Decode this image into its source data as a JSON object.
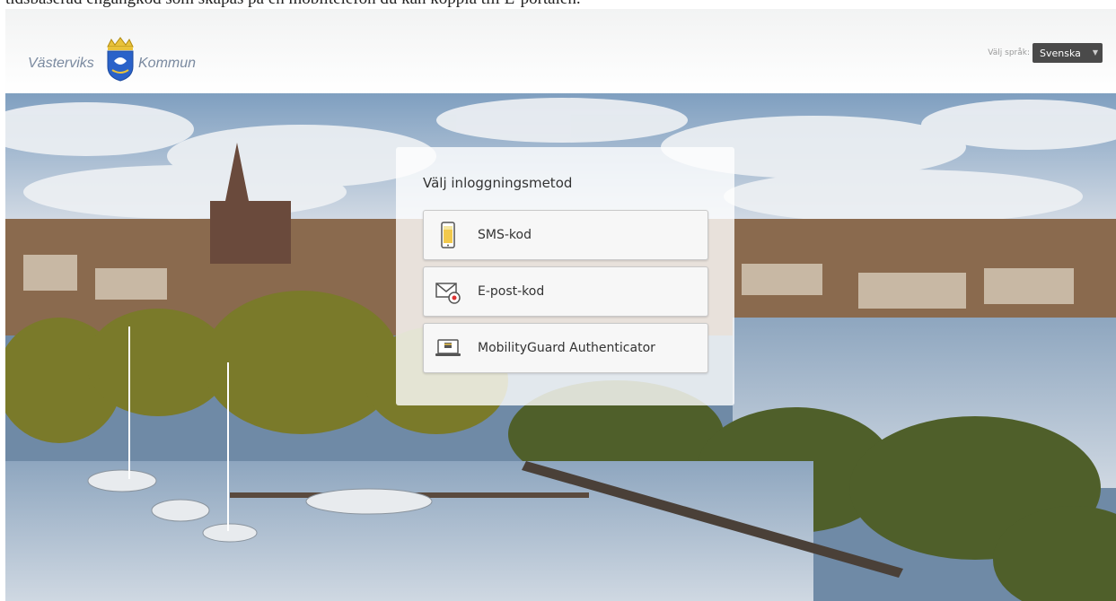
{
  "caption": "tidsbaserad engångkod som skapas på en mobiltelefon du kan koppla till E-portalen.",
  "header": {
    "logo_left": "Västerviks",
    "logo_right": "Kommun",
    "lang_label": "Välj språk:",
    "lang_value": "Svenska"
  },
  "login": {
    "title": "Välj inloggningsmetod",
    "methods": [
      {
        "label": "SMS-kod",
        "icon": "phone-icon"
      },
      {
        "label": "E-post-kod",
        "icon": "envelope-icon"
      },
      {
        "label": "MobilityGuard Authenticator",
        "icon": "laptop-icon"
      }
    ]
  },
  "colors": {
    "select_bg": "#4a4a4a",
    "crest_blue": "#2a62c9",
    "crest_gold": "#e8c23a"
  }
}
